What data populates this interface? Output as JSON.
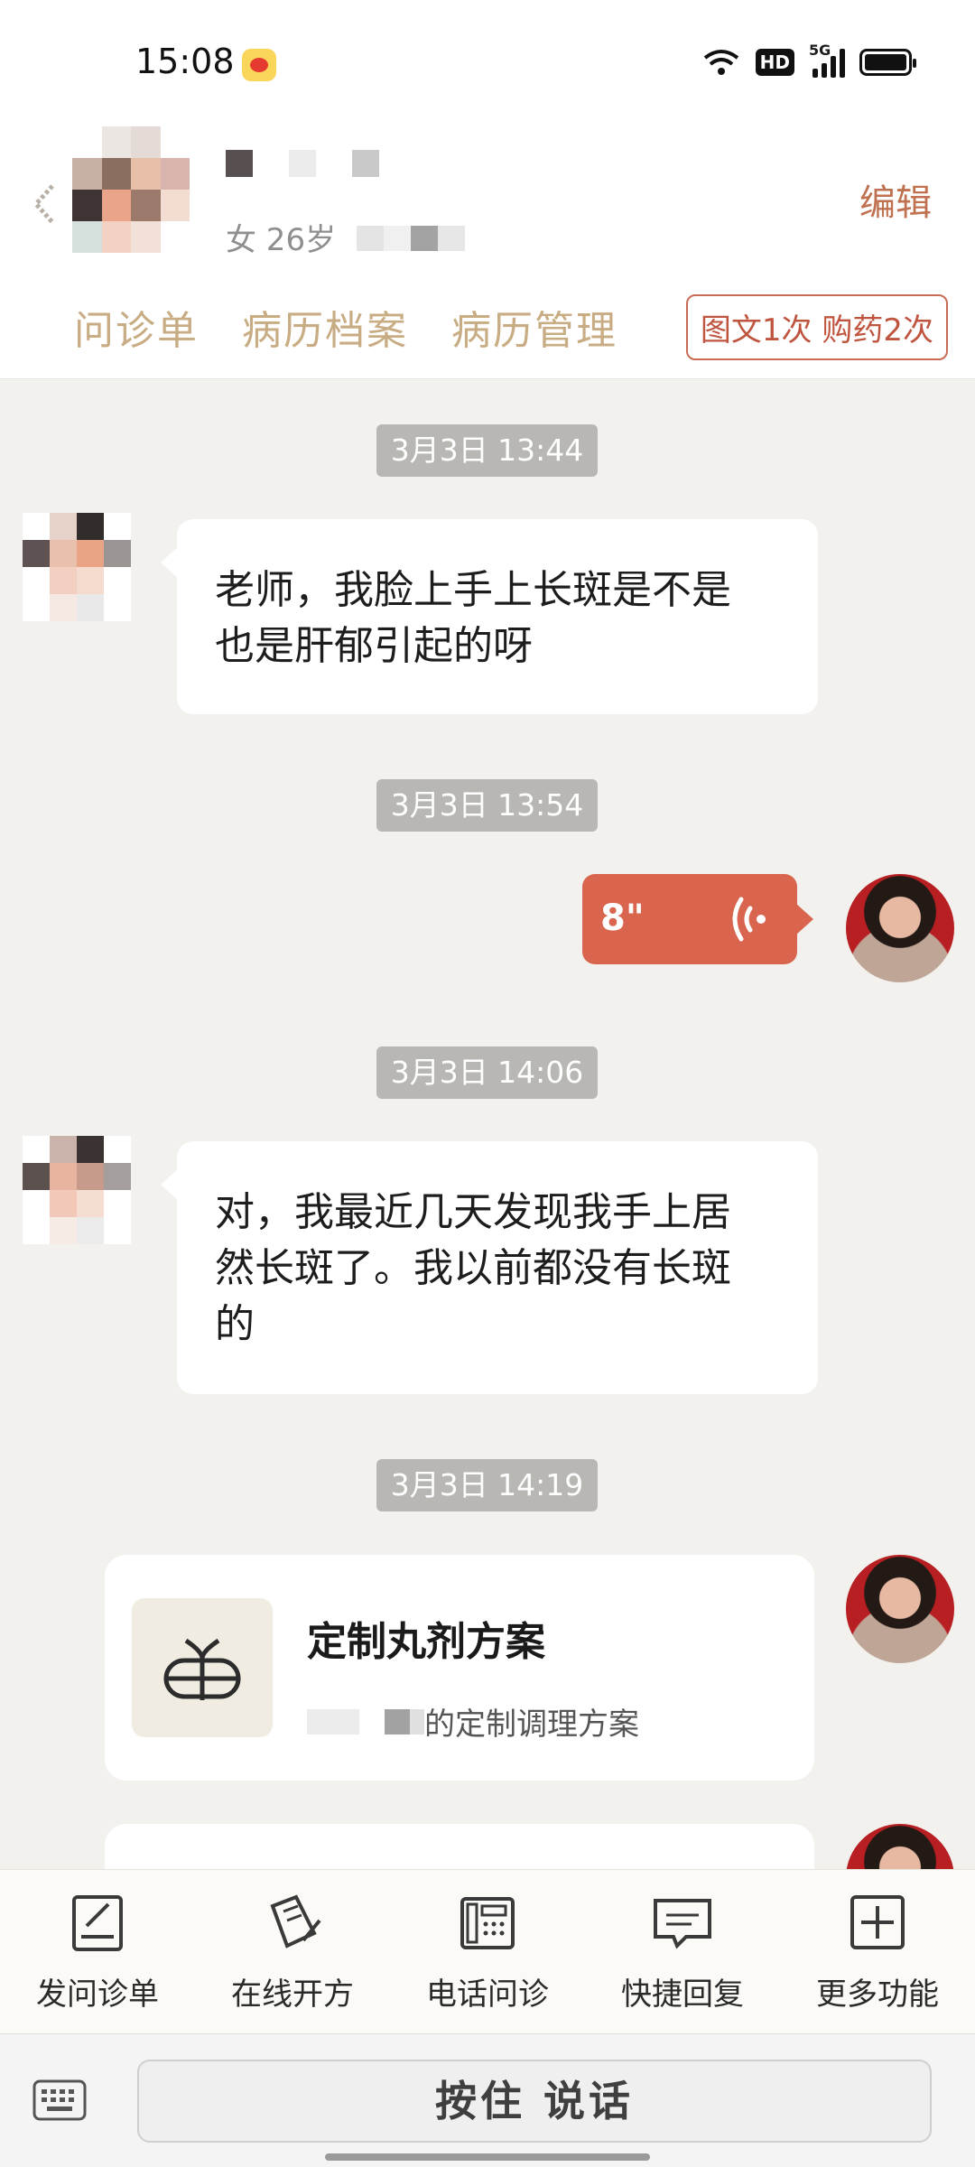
{
  "status_bar": {
    "time": "15:08",
    "network": "5G",
    "hd_label": "HD"
  },
  "header": {
    "patient_info": "女 26岁",
    "edit_label": "编辑",
    "tabs": [
      {
        "label": "问诊单"
      },
      {
        "label": "病历档案"
      },
      {
        "label": "病历管理"
      }
    ],
    "consult_badge": "图文1次 购药2次"
  },
  "chat": {
    "messages": [
      {
        "timestamp": "3月3日 13:44",
        "sender": "patient",
        "type": "text",
        "text_lines": [
          "老师，我脸上手上长斑是不是",
          "也是肝郁引起的呀"
        ]
      },
      {
        "timestamp": "3月3日 13:54",
        "sender": "doctor",
        "type": "voice",
        "duration": "8\""
      },
      {
        "timestamp": "3月3日 14:06",
        "sender": "patient",
        "type": "text",
        "text_lines": [
          "对，我最近几天发现我手上居",
          "然长斑了。我以前都没有长斑",
          "的"
        ]
      },
      {
        "timestamp": "3月3日 14:19",
        "sender": "doctor",
        "type": "card",
        "card_title": "定制丸剂方案",
        "card_subtitle": "的定制调理方案"
      }
    ]
  },
  "toolbar": {
    "items": [
      {
        "label": "发问诊单",
        "icon": "form-icon"
      },
      {
        "label": "在线开方",
        "icon": "prescription-icon"
      },
      {
        "label": "电话问诊",
        "icon": "phone-icon"
      },
      {
        "label": "快捷回复",
        "icon": "chat-bubble-icon"
      },
      {
        "label": "更多功能",
        "icon": "plus-box-icon"
      }
    ]
  },
  "input_bar": {
    "talk_label": "按住 说话"
  },
  "colors": {
    "accent": "#d9654e",
    "tab_text": "#c8ac83",
    "timestamp_bg": "#b8b7b3",
    "chat_bg": "#f2f1ed"
  }
}
